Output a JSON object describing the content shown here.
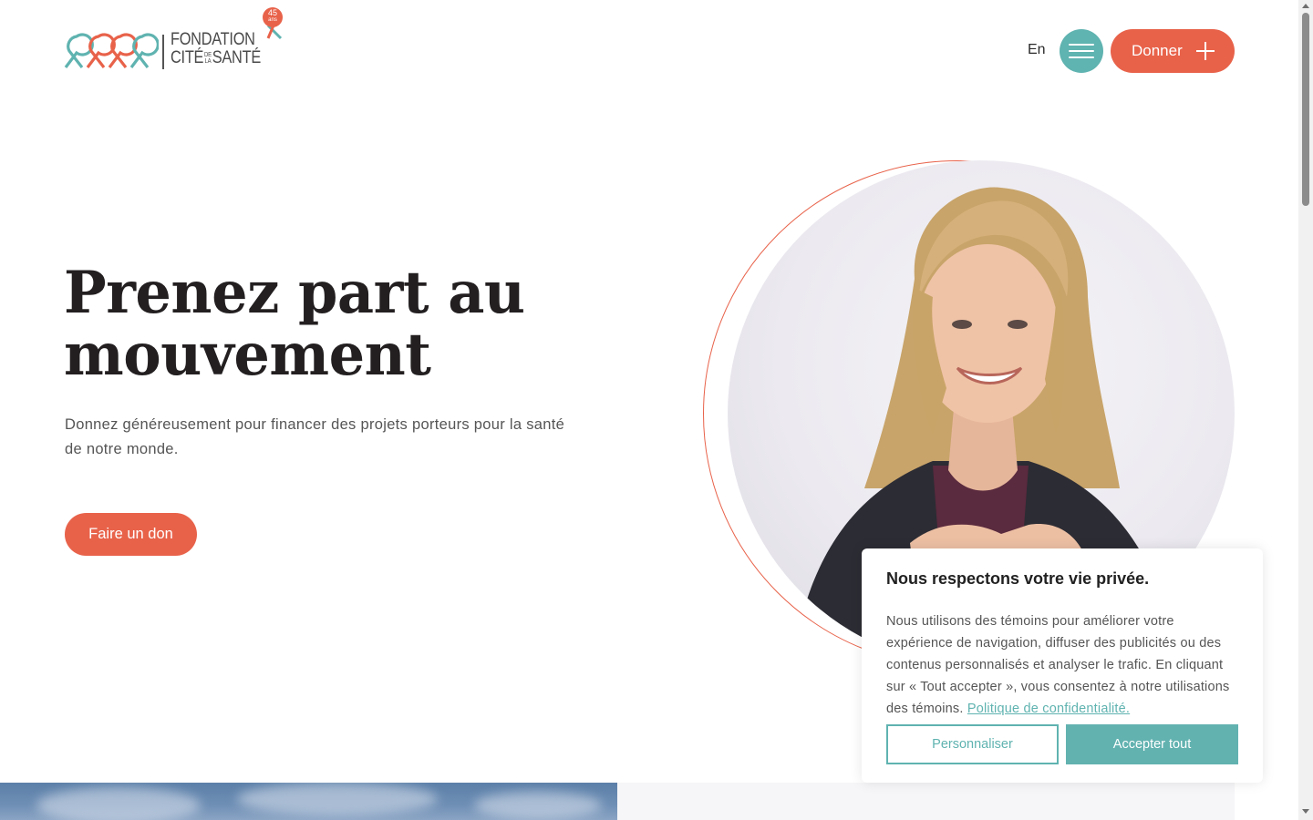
{
  "header": {
    "logo": {
      "line1": "FONDATION",
      "line2_a": "CITÉ",
      "line2_de": "DE",
      "line2_la": "LA",
      "line2_b": "SANTÉ",
      "badge_number": "45",
      "badge_unit": "ans"
    },
    "lang_label": "En",
    "donate_label": "Donner"
  },
  "hero": {
    "title_line1": "Prenez part au",
    "title_line2": "mouvement",
    "subtitle": "Donnez généreusement pour financer des projets porteurs pour la santé de notre monde.",
    "cta_label": "Faire un don"
  },
  "cookie": {
    "title": "Nous respectons votre vie privée.",
    "text": "Nous utilisons des témoins pour améliorer votre expérience de navigation, diffuser des publicités ou des contenus personnalisés et analyser le trafic. En cliquant sur « Tout accepter », vous consentez à notre utilisations des témoins. ",
    "link_label": "Politique de confidentialité.",
    "customize_label": "Personnaliser",
    "accept_label": "Accepter tout"
  },
  "colors": {
    "accent_coral": "#e8624a",
    "accent_teal": "#5fb3b0"
  },
  "icons": {
    "menu": "hamburger-icon",
    "donate": "plus-icon"
  }
}
